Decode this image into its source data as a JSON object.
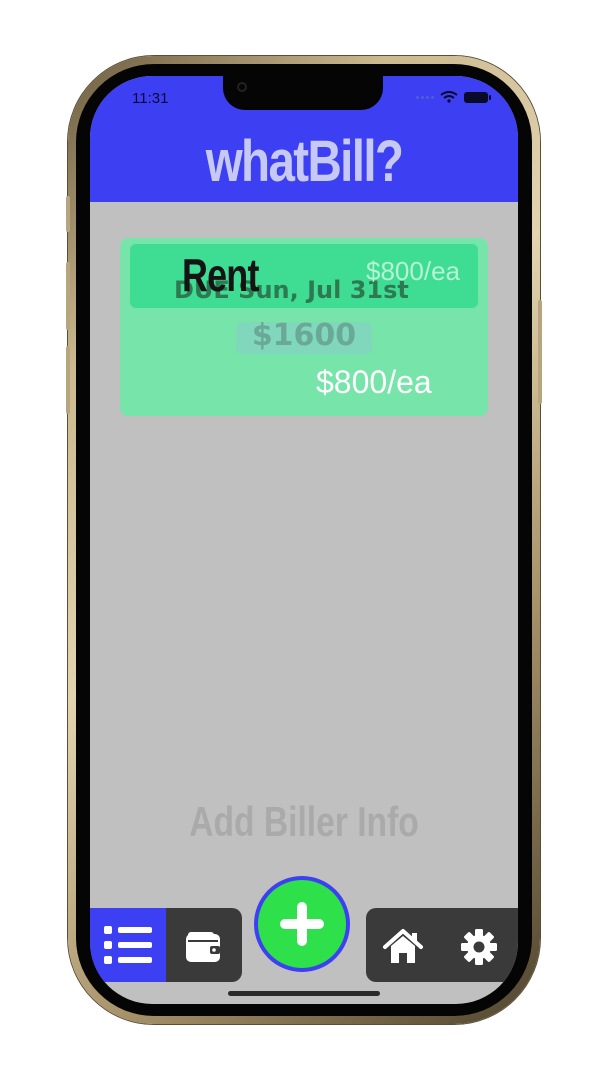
{
  "status_bar": {
    "time": "11:31"
  },
  "header": {
    "title": "whatBill?"
  },
  "bill_card": {
    "name": "Rent",
    "due": "DUE Sun, Jul 31st",
    "per_person_top": "$800/ea",
    "total": "$1600",
    "per_person": "$800/ea"
  },
  "empty_hint": "Add Biller Info",
  "nav": {
    "items": [
      {
        "icon": "list-icon",
        "active": true
      },
      {
        "icon": "wallet-icon",
        "active": false
      },
      {
        "icon": "plus-icon",
        "active": false
      },
      {
        "icon": "home-icon",
        "active": false
      },
      {
        "icon": "gear-icon",
        "active": false
      }
    ]
  },
  "colors": {
    "header": "#3d3ff2",
    "card": "#77e4aa",
    "add_button": "#2ee14a",
    "background": "#c0c0c0",
    "nav": "#3a3a3a"
  }
}
